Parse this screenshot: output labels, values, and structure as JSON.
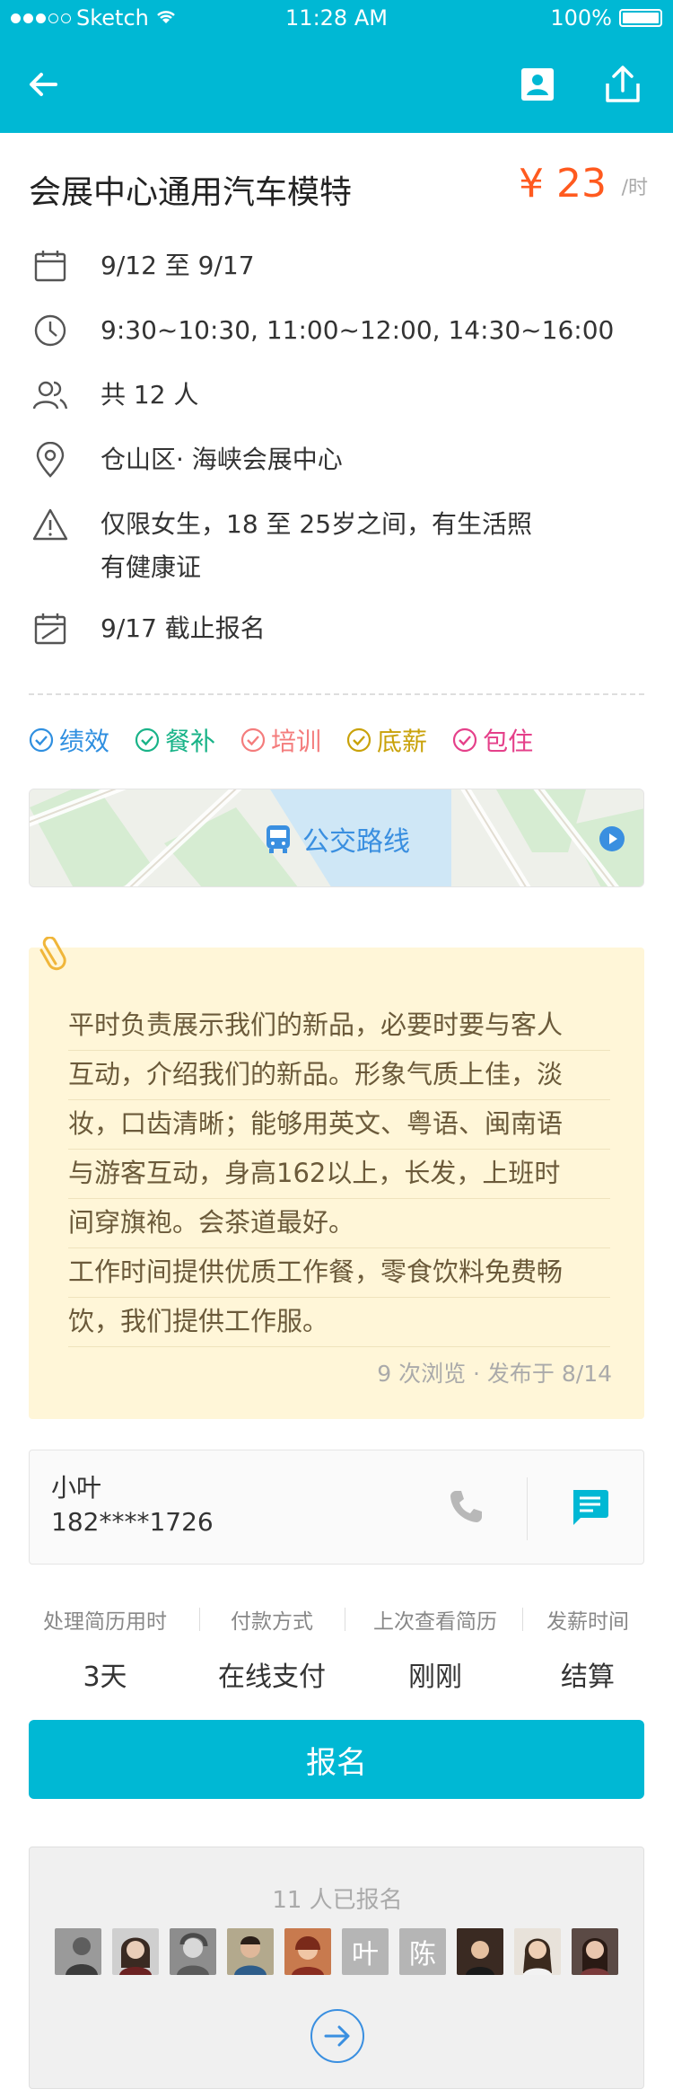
{
  "status_bar": {
    "carrier": "Sketch",
    "time": "11:28 AM",
    "battery": "100%"
  },
  "job": {
    "title": "会展中心通用汽车模特",
    "price": "¥ 23",
    "unit": "/时"
  },
  "info": {
    "date_range": "9/12 至 9/17",
    "hours": "9:30~10:30, 11:00~12:00, 14:30~16:00",
    "headcount": "共 12 人",
    "location": "仓山区· 海峡会展中心",
    "requirement_line1": "仅限女生，18 至 25岁之间，有生活照",
    "requirement_line2": "有健康证",
    "deadline": "9/17 截止报名"
  },
  "tags": [
    {
      "label": "绩效",
      "color": "#2f8fe0"
    },
    {
      "label": "餐补",
      "color": "#19b388"
    },
    {
      "label": "培训",
      "color": "#f47c7c"
    },
    {
      "label": "底薪",
      "color": "#c9a20a"
    },
    {
      "label": "包住",
      "color": "#e5408a"
    }
  ],
  "map": {
    "label": "公交路线"
  },
  "description": {
    "lines": [
      "平时负责展示我们的新品，必要时要与客人",
      "互动，介绍我们的新品。形象气质上佳，淡",
      "妆，口齿清晰；能够用英文、粤语、闽南语",
      "与游客互动，身高162以上，长发，上班时",
      "间穿旗袍。会茶道最好。",
      "工作时间提供优质工作餐，零食饮料免费畅",
      "饮，我们提供工作服。"
    ],
    "meta": "9 次浏览 · 发布于 8/14"
  },
  "contact": {
    "name": "小叶",
    "phone": "182****1726"
  },
  "stats": [
    {
      "label": "处理简历用时",
      "value": "3天"
    },
    {
      "label": "付款方式",
      "value": "在线支付"
    },
    {
      "label": "上次查看简历",
      "value": "刚刚"
    },
    {
      "label": "发薪时间",
      "value": "结算"
    }
  ],
  "signup_label": "报名",
  "applicants": {
    "count_text": "11 人已报名",
    "text_avatars": [
      "叶",
      "陈"
    ]
  },
  "colors": {
    "brand": "#00b8d4",
    "price": "#ff5a1f",
    "link": "#3a8fe0"
  }
}
